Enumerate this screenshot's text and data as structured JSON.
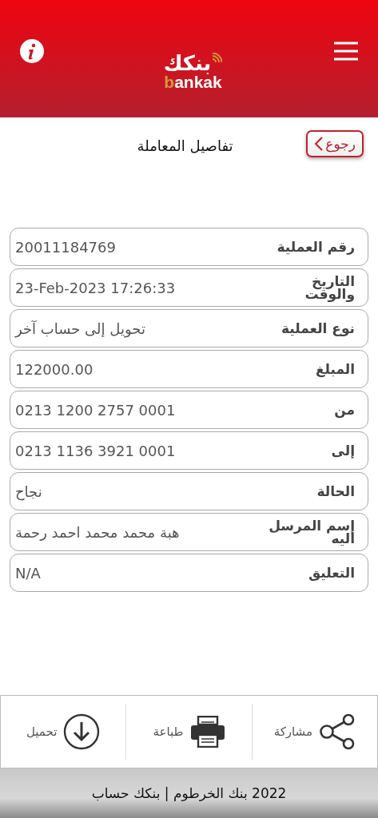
{
  "header": {
    "logo": {
      "arabic": "بنكك",
      "latin_first": "b",
      "latin_rest": "ankak"
    }
  },
  "title_bar": {
    "back_button": "رجوع",
    "title": "تفاصيل المعاملة"
  },
  "details": [
    {
      "label": "رقم العملية",
      "value": "20011184769"
    },
    {
      "label": "التاريخ\nوالوقت",
      "value": "23-Feb-2023 17:26:33"
    },
    {
      "label": "نوع العملية",
      "value": "تحويل إلى حساب آخر"
    },
    {
      "label": "المبلغ",
      "value": "122000.00"
    },
    {
      "label": "من",
      "value": "0213 1200 2757 0001"
    },
    {
      "label": "إلى",
      "value": "0213 1136 3921 0001"
    },
    {
      "label": "الحالة",
      "value": "نجاح"
    },
    {
      "label": "إسم المرسل\nاليه",
      "value": "هبة محمد محمد احمد رحمة"
    },
    {
      "label": "التعليق",
      "value": "N/A"
    }
  ],
  "actions": [
    {
      "kind": "share",
      "label": "مشاركة"
    },
    {
      "kind": "print",
      "label": "طباعة"
    },
    {
      "kind": "download",
      "label": "تحميل"
    }
  ],
  "footer": "2022 بنك الخرطوم | بنكك حساب"
}
